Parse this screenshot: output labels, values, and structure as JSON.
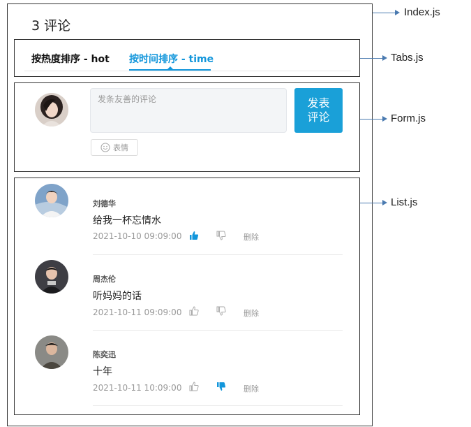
{
  "header": {
    "comment_count": "3 评论"
  },
  "tabs": [
    {
      "label": "按热度排序 - hot",
      "active": false
    },
    {
      "label": "按时间排序 - time",
      "active": true
    }
  ],
  "form": {
    "placeholder": "发条友善的评论",
    "submit_line1": "发表",
    "submit_line2": "评论",
    "emoji_label": "表情"
  },
  "comments": [
    {
      "user": "刘德华",
      "content": "给我一杯忘情水",
      "time": "2021-10-10 09:09:00",
      "liked": true,
      "disliked": false,
      "delete_label": "删除"
    },
    {
      "user": "周杰伦",
      "content": "听妈妈的话",
      "time": "2021-10-11 09:09:00",
      "liked": false,
      "disliked": false,
      "delete_label": "删除"
    },
    {
      "user": "陈奕迅",
      "content": "十年",
      "time": "2021-10-11 10:09:00",
      "liked": false,
      "disliked": true,
      "delete_label": "删除"
    }
  ],
  "annotations": {
    "index": "Index.js",
    "tabs": "Tabs.js",
    "form": "Form.js",
    "list": "List.js"
  },
  "colors": {
    "accent": "#1296db",
    "button": "#1aa0d8",
    "callout": "#4a7ab0"
  }
}
